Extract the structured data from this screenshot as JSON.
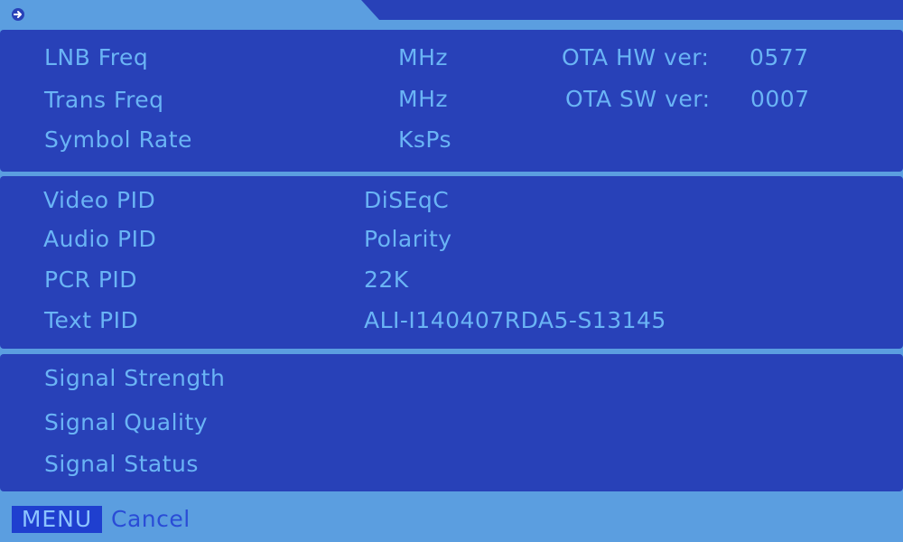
{
  "tuner": {
    "lnb_freq_label": "LNB Freq",
    "lnb_freq_unit": "MHz",
    "trans_freq_label": "Trans Freq",
    "trans_freq_unit": "MHz",
    "symbol_rate_label": "Symbol Rate",
    "symbol_rate_unit": "KsPs",
    "ota_hw_label": "OTA HW ver:",
    "ota_hw_value": "0577",
    "ota_sw_label": "OTA SW ver:",
    "ota_sw_value": "0007"
  },
  "pids": {
    "video_pid_label": "Video PID",
    "audio_pid_label": "Audio PID",
    "pcr_pid_label": "PCR PID",
    "text_pid_label": "Text PID",
    "diseqc_label": "DiSEqC",
    "polarity_label": "Polarity",
    "tone_label": "22K",
    "firmware_version": "ALI-I140407RDA5-S13145"
  },
  "signal": {
    "strength_label": "Signal Strength",
    "quality_label": "Signal Quality",
    "status_label": "Signal Status"
  },
  "footer": {
    "menu_key": "MENU",
    "cancel_label": "Cancel"
  },
  "colors": {
    "panel": "#2841b8",
    "frame": "#5b9ee0",
    "text": "#6ab4f5",
    "key_bg": "#1f3fcf"
  },
  "icons": {
    "back": "back-arrow-icon"
  }
}
